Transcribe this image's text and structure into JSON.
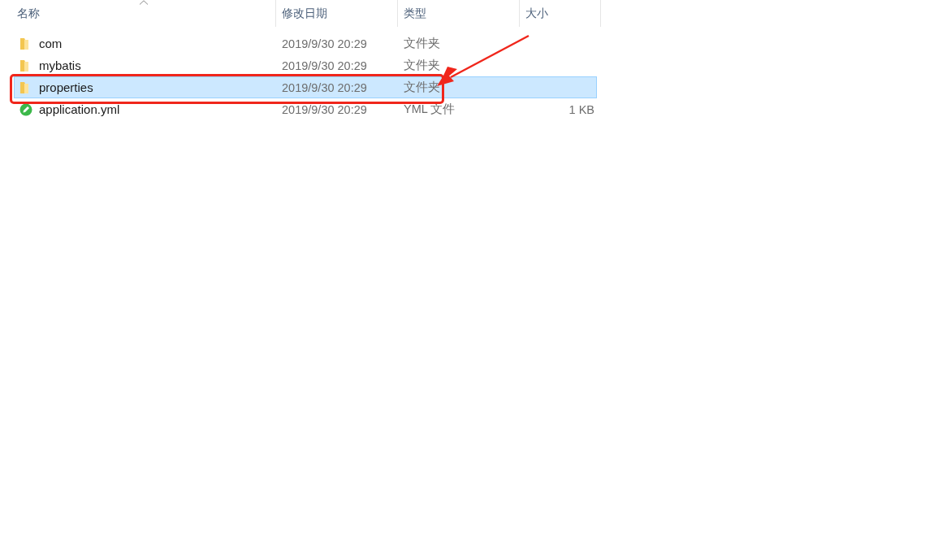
{
  "columns": [
    {
      "label": "名称",
      "sorted": true
    },
    {
      "label": "修改日期",
      "sorted": false
    },
    {
      "label": "类型",
      "sorted": false
    },
    {
      "label": "大小",
      "sorted": false
    }
  ],
  "rows": [
    {
      "kind": "folder",
      "name": "com",
      "modified": "2019/9/30 20:29",
      "type": "文件夹",
      "selected": false,
      "highlighted": false
    },
    {
      "kind": "folder",
      "name": "mybatis",
      "modified": "2019/9/30 20:29",
      "type": "文件夹",
      "selected": false,
      "highlighted": false
    },
    {
      "kind": "folder",
      "name": "properties",
      "modified": "2019/9/30 20:29",
      "type": "文件夹",
      "selected": true,
      "highlighted": true
    },
    {
      "kind": "yml",
      "name": "application.yml",
      "modified": "2019/9/30 20:29",
      "type": "YML 文件",
      "size": "1 KB",
      "selected": false,
      "highlighted": false
    }
  ]
}
